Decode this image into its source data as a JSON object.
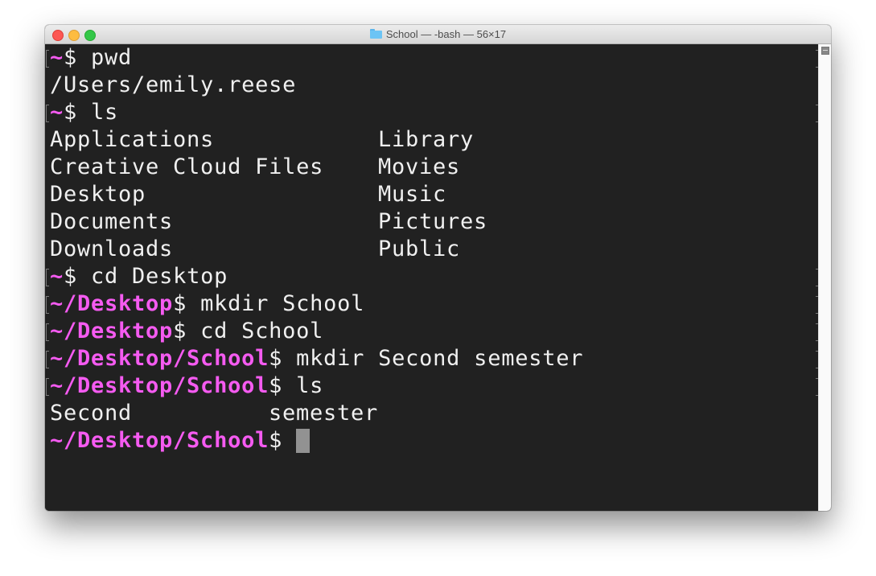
{
  "window": {
    "title": "School — -bash — 56×17",
    "title_icon": "folder-icon",
    "controls": [
      "close",
      "minimize",
      "zoom"
    ]
  },
  "colors": {
    "background": "#212121",
    "text": "#f0f0f0",
    "prompt": "#f55bf1",
    "cursor": "#929292"
  },
  "terminal": {
    "lines": [
      {
        "type": "command",
        "prompt": "~",
        "dollar": "$",
        "command": " pwd"
      },
      {
        "type": "output",
        "text": "/Users/emily.reese"
      },
      {
        "type": "command",
        "prompt": "~",
        "dollar": "$",
        "command": " ls"
      },
      {
        "type": "output2",
        "col1": "Applications",
        "col2": "Library"
      },
      {
        "type": "output2",
        "col1": "Creative Cloud Files",
        "col2": "Movies"
      },
      {
        "type": "output2",
        "col1": "Desktop",
        "col2": "Music"
      },
      {
        "type": "output2",
        "col1": "Documents",
        "col2": "Pictures"
      },
      {
        "type": "output2",
        "col1": "Downloads",
        "col2": "Public"
      },
      {
        "type": "command",
        "prompt": "~",
        "dollar": "$",
        "command": " cd Desktop"
      },
      {
        "type": "command",
        "prompt": "~/Desktop",
        "dollar": "$",
        "command": " mkdir School"
      },
      {
        "type": "command",
        "prompt": "~/Desktop",
        "dollar": "$",
        "command": " cd School"
      },
      {
        "type": "command",
        "prompt": "~/Desktop/School",
        "dollar": "$",
        "command": " mkdir Second semester"
      },
      {
        "type": "command",
        "prompt": "~/Desktop/School",
        "dollar": "$",
        "command": " ls"
      },
      {
        "type": "output2b",
        "col1": "Second",
        "col2": "semester"
      },
      {
        "type": "current",
        "prompt": "~/Desktop/School",
        "dollar": "$",
        "command": " "
      }
    ]
  }
}
